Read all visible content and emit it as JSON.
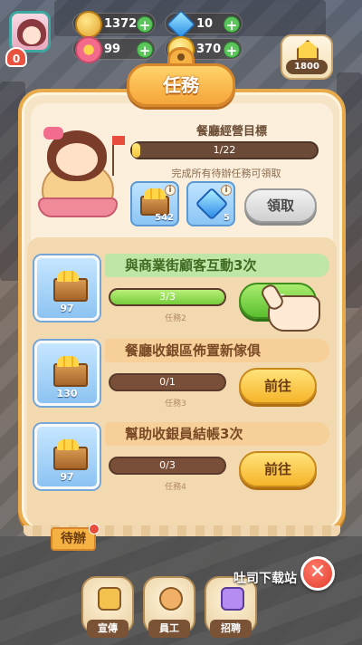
{
  "hud": {
    "level": "0",
    "coins": "1372",
    "gems": "10",
    "flowers": "99",
    "stars": "370",
    "home_value": "1800"
  },
  "panel": {
    "title": "任務",
    "goal_title": "餐廳經營目標",
    "goal_progress_text": "1/22",
    "goal_progress_fraction": 0.045,
    "goal_hint": "完成所有待辦任務可領取",
    "rewards": [
      {
        "icon": "coin-crate-icon",
        "count": "542"
      },
      {
        "icon": "diamond-icon",
        "count": "5"
      }
    ],
    "claim_label": "領取"
  },
  "quests": [
    {
      "title": "與商業街顧客互動3次",
      "reward_count": "97",
      "progress_text": "3/3",
      "progress_fraction": 1.0,
      "quest_id": "任務2",
      "button": "領"
    },
    {
      "title": "餐廳收銀區佈置新傢俱",
      "reward_count": "130",
      "progress_text": "0/1",
      "progress_fraction": 0,
      "quest_id": "任務3",
      "button": "前往"
    },
    {
      "title": "幫助收銀員結帳3次",
      "reward_count": "97",
      "progress_text": "0/3",
      "progress_fraction": 0,
      "quest_id": "任務4",
      "button": "前往"
    }
  ],
  "bottom": {
    "pending_tab": "待辦",
    "buttons": [
      {
        "label": "宣傳"
      },
      {
        "label": "員工"
      },
      {
        "label": "招聘"
      }
    ]
  },
  "watermark": "吐司下载站",
  "colors": {
    "panel_bg": "#f6e4c6",
    "panel_border": "#e9aa4c",
    "go_button": "#f6b42a",
    "claim_button_active": "#5abf2f",
    "close_button": "#e33a2c"
  }
}
